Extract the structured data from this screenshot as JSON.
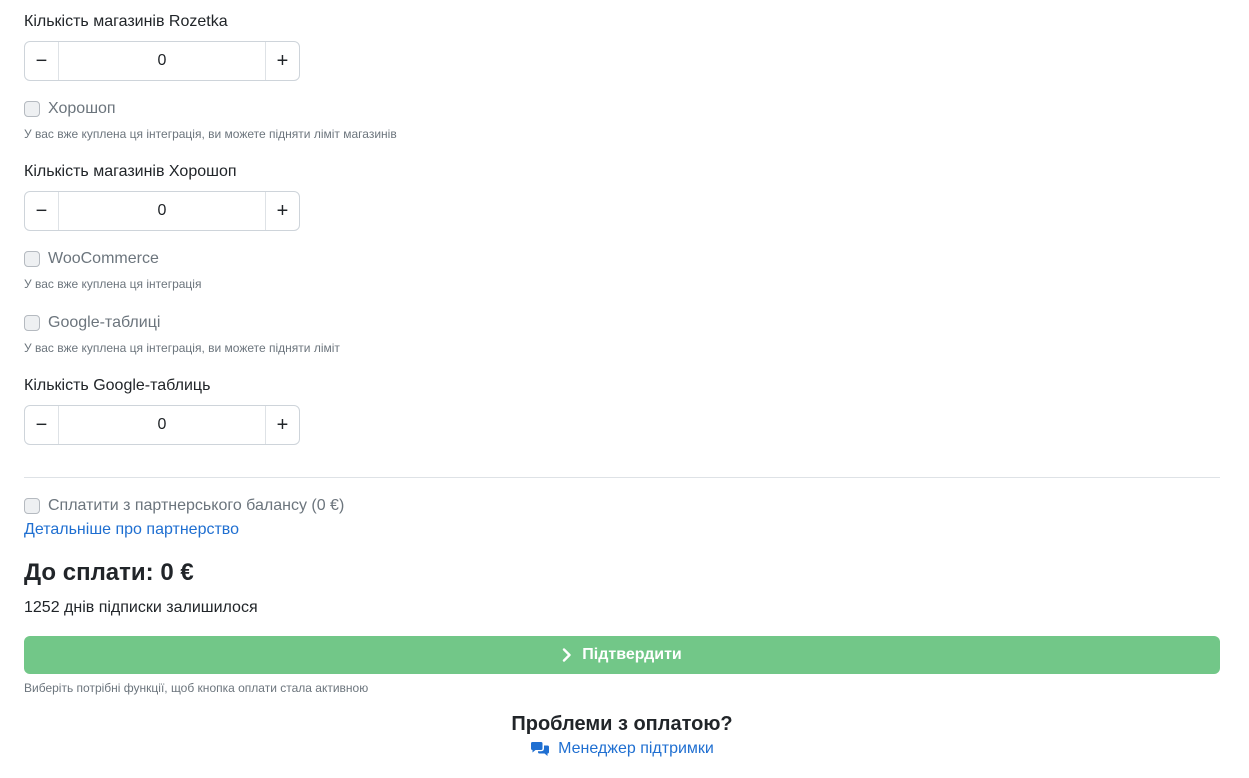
{
  "rozetka": {
    "count_label": "Кількість магазинів Rozetka",
    "count_value": "0",
    "minus": "−",
    "plus": "+"
  },
  "horoshop": {
    "checkbox_label": "Хорошоп",
    "hint": "У вас вже куплена ця інтеграція, ви можете підняти ліміт магазинів",
    "count_label": "Кількість магазинів Хорошоп",
    "count_value": "0",
    "minus": "−",
    "plus": "+"
  },
  "woocommerce": {
    "checkbox_label": "WooCommerce",
    "hint": "У вас вже куплена ця інтеграція"
  },
  "google_sheets": {
    "checkbox_label": "Google-таблиці",
    "hint": "У вас вже куплена ця інтеграція, ви можете підняти ліміт",
    "count_label": "Кількість Google-таблиць",
    "count_value": "0",
    "minus": "−",
    "plus": "+"
  },
  "partner": {
    "checkbox_label": "Сплатити з партнерського балансу (0 €)",
    "details_link": "Детальніше про партнерство"
  },
  "summary": {
    "total": "До сплати: 0 €",
    "days_left": "1252 днів підписки залишилося"
  },
  "confirm": {
    "label": "Підтвердити",
    "hint": "Виберіть потрібні функції, щоб кнопка оплати стала активною",
    "icon": "chevron-right-icon",
    "color": "#72c788"
  },
  "support": {
    "title": "Проблеми з оплатою?",
    "link": "Менеджер підтримки",
    "icon": "chat-icon"
  },
  "colors": {
    "link": "#1f6fd1",
    "muted_text": "#6c757d",
    "text": "#212529"
  }
}
